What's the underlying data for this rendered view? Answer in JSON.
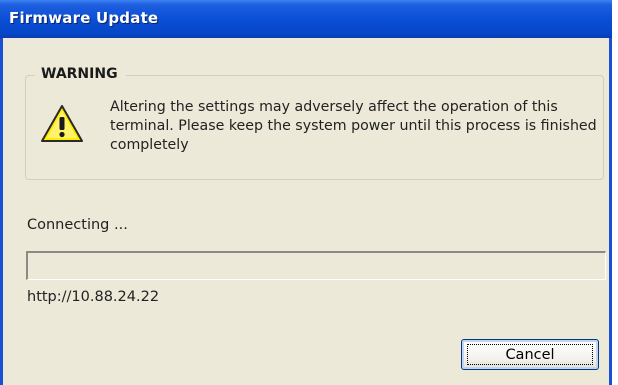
{
  "window": {
    "title": "Firmware Update"
  },
  "warning": {
    "heading": "WARNING",
    "message": "Altering the settings may adversely affect the operation of this terminal. Please keep the system power until this process is finished completely",
    "icon": "warning-icon"
  },
  "status": {
    "text": "Connecting ..."
  },
  "progress": {
    "value": 0
  },
  "connection": {
    "url": "http://10.88.24.22"
  },
  "buttons": {
    "cancel_label": "Cancel"
  },
  "colors": {
    "titlebar": "#0a4fd6",
    "window_bg": "#ece9d8",
    "button_border": "#003c74"
  }
}
